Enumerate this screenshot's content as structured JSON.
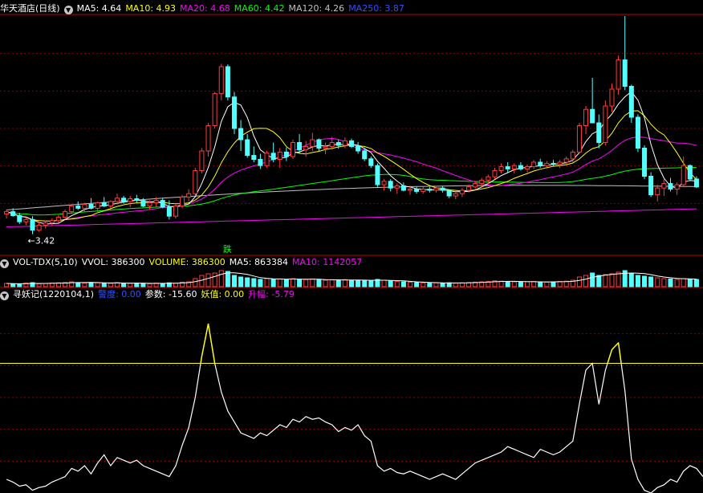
{
  "panel1": {
    "title": "华天酒店(日线)",
    "ma": [
      {
        "label": "MA5: 4.64",
        "color": "#ffffff"
      },
      {
        "label": "MA10: 4.93",
        "color": "#ffff00"
      },
      {
        "label": "MA20: 4.68",
        "color": "#ff00ff"
      },
      {
        "label": "MA60: 4.42",
        "color": "#00ff00"
      },
      {
        "label": "MA120: 4.26",
        "color": "#c0c0c0"
      },
      {
        "label": "MA250: 3.87",
        "color": "#3050ff"
      }
    ],
    "low_label": "←3.42",
    "event_label": "跌"
  },
  "panel2": {
    "title": "VOL-TDX(5,10)",
    "items": [
      {
        "label": "VVOL: 386300",
        "color": "#ffffff"
      },
      {
        "label": "VOLUME: 386300",
        "color": "#ffff00"
      },
      {
        "label": "MA5: 863384",
        "color": "#ffffff"
      },
      {
        "label": "MA10: 1142057",
        "color": "#ff00ff"
      }
    ]
  },
  "panel3": {
    "title": "寻妖记(1220104,1)",
    "items": [
      {
        "label": "警度: 0.00",
        "color": "#3050ff"
      },
      {
        "label": "参数: -15.60",
        "color": "#ffffff"
      },
      {
        "label": "妖值: 0.00",
        "color": "#ffff00"
      },
      {
        "label": "升幅: -5.79",
        "color": "#ff00ff"
      }
    ]
  },
  "colors": {
    "up": "#ff3c3c",
    "down": "#54ffff",
    "grid": "#8a0000",
    "frame": "#c00000"
  },
  "chart_data": {
    "type": "line",
    "price_range": [
      3.3,
      7.3
    ],
    "indicator_range": [
      -30,
      110
    ],
    "threshold": 65,
    "candles": [
      [
        3.78,
        3.86,
        3.7,
        3.82
      ],
      [
        3.82,
        3.88,
        3.73,
        3.75
      ],
      [
        3.75,
        3.8,
        3.6,
        3.64
      ],
      [
        3.64,
        3.72,
        3.58,
        3.68
      ],
      [
        3.68,
        3.74,
        3.42,
        3.49
      ],
      [
        3.49,
        3.64,
        3.46,
        3.58
      ],
      [
        3.58,
        3.66,
        3.52,
        3.62
      ],
      [
        3.62,
        3.7,
        3.57,
        3.66
      ],
      [
        3.66,
        3.76,
        3.62,
        3.72
      ],
      [
        3.72,
        3.86,
        3.68,
        3.82
      ],
      [
        3.82,
        3.96,
        3.78,
        3.92
      ],
      [
        3.92,
        4.0,
        3.85,
        3.88
      ],
      [
        3.88,
        3.98,
        3.82,
        3.95
      ],
      [
        3.95,
        4.06,
        3.86,
        3.88
      ],
      [
        3.88,
        4.0,
        3.8,
        3.98
      ],
      [
        3.98,
        4.08,
        3.9,
        3.92
      ],
      [
        3.92,
        4.02,
        3.88,
        4.0
      ],
      [
        4.0,
        4.14,
        3.95,
        4.06
      ],
      [
        4.06,
        4.1,
        3.96,
        4.0
      ],
      [
        4.0,
        4.1,
        3.9,
        4.05
      ],
      [
        4.05,
        4.12,
        3.98,
        4.02
      ],
      [
        4.02,
        4.06,
        3.9,
        3.92
      ],
      [
        3.92,
        4.02,
        3.86,
        3.98
      ],
      [
        3.98,
        4.08,
        3.9,
        4.02
      ],
      [
        4.02,
        4.06,
        3.88,
        3.9
      ],
      [
        3.9,
        4.02,
        3.68,
        3.74
      ],
      [
        3.74,
        3.96,
        3.7,
        3.92
      ],
      [
        3.92,
        4.12,
        3.88,
        4.08
      ],
      [
        4.08,
        4.22,
        4.0,
        4.14
      ],
      [
        4.14,
        4.6,
        4.1,
        4.55
      ],
      [
        4.55,
        4.95,
        4.5,
        4.9
      ],
      [
        4.9,
        5.4,
        4.8,
        5.35
      ],
      [
        5.35,
        5.95,
        5.3,
        5.92
      ],
      [
        5.92,
        6.45,
        5.8,
        6.4
      ],
      [
        6.4,
        6.44,
        5.8,
        5.86
      ],
      [
        5.86,
        5.95,
        5.2,
        5.3
      ],
      [
        5.3,
        5.45,
        4.9,
        5.1
      ],
      [
        5.1,
        5.2,
        4.78,
        4.82
      ],
      [
        4.82,
        4.98,
        4.7,
        4.75
      ],
      [
        4.75,
        4.85,
        4.58,
        4.64
      ],
      [
        4.64,
        4.9,
        4.6,
        4.86
      ],
      [
        4.86,
        5.05,
        4.7,
        4.75
      ],
      [
        4.75,
        4.95,
        4.6,
        4.88
      ],
      [
        4.88,
        4.96,
        4.72,
        4.8
      ],
      [
        4.8,
        5.1,
        4.76,
        5.05
      ],
      [
        5.05,
        5.2,
        4.86,
        4.92
      ],
      [
        4.92,
        5.08,
        4.8,
        4.98
      ],
      [
        4.98,
        5.22,
        4.9,
        5.1
      ],
      [
        5.1,
        5.12,
        4.9,
        4.95
      ],
      [
        4.95,
        5.05,
        4.84,
        4.98
      ],
      [
        4.98,
        5.15,
        4.92,
        5.05
      ],
      [
        5.05,
        5.1,
        4.94,
        5.0
      ],
      [
        5.0,
        5.14,
        4.95,
        5.08
      ],
      [
        5.08,
        5.12,
        4.95,
        4.98
      ],
      [
        4.98,
        5.06,
        4.85,
        4.9
      ],
      [
        4.9,
        4.95,
        4.72,
        4.76
      ],
      [
        4.76,
        4.8,
        4.6,
        4.64
      ],
      [
        4.64,
        4.68,
        4.26,
        4.3
      ],
      [
        4.3,
        4.4,
        4.2,
        4.36
      ],
      [
        4.36,
        4.4,
        4.18,
        4.24
      ],
      [
        4.24,
        4.32,
        4.14,
        4.28
      ],
      [
        4.28,
        4.34,
        4.18,
        4.2
      ],
      [
        4.2,
        4.28,
        4.12,
        4.22
      ],
      [
        4.22,
        4.26,
        4.14,
        4.18
      ],
      [
        4.18,
        4.26,
        4.14,
        4.22
      ],
      [
        4.22,
        4.26,
        4.16,
        4.2
      ],
      [
        4.2,
        4.28,
        4.16,
        4.24
      ],
      [
        4.24,
        4.28,
        4.16,
        4.2
      ],
      [
        4.2,
        4.22,
        4.06,
        4.1
      ],
      [
        4.1,
        4.18,
        4.04,
        4.14
      ],
      [
        4.14,
        4.24,
        4.08,
        4.2
      ],
      [
        4.2,
        4.3,
        4.16,
        4.26
      ],
      [
        4.26,
        4.36,
        4.22,
        4.32
      ],
      [
        4.32,
        4.42,
        4.26,
        4.38
      ],
      [
        4.38,
        4.48,
        4.3,
        4.44
      ],
      [
        4.44,
        4.6,
        4.4,
        4.55
      ],
      [
        4.55,
        4.68,
        4.5,
        4.62
      ],
      [
        4.62,
        4.7,
        4.52,
        4.58
      ],
      [
        4.58,
        4.68,
        4.5,
        4.64
      ],
      [
        4.64,
        4.7,
        4.55,
        4.58
      ],
      [
        4.58,
        4.66,
        4.52,
        4.62
      ],
      [
        4.62,
        4.74,
        4.58,
        4.7
      ],
      [
        4.7,
        4.76,
        4.6,
        4.64
      ],
      [
        4.64,
        4.72,
        4.58,
        4.68
      ],
      [
        4.68,
        4.74,
        4.62,
        4.66
      ],
      [
        4.66,
        4.74,
        4.6,
        4.7
      ],
      [
        4.7,
        4.8,
        4.66,
        4.76
      ],
      [
        4.76,
        4.92,
        4.7,
        4.88
      ],
      [
        4.88,
        5.4,
        4.85,
        5.35
      ],
      [
        5.35,
        5.7,
        5.2,
        5.64
      ],
      [
        5.64,
        6.2,
        5.5,
        5.4
      ],
      [
        5.4,
        5.55,
        4.95,
        5.05
      ],
      [
        5.05,
        5.8,
        5.0,
        5.7
      ],
      [
        5.7,
        6.1,
        5.6,
        6.0
      ],
      [
        6.0,
        6.6,
        5.9,
        6.52
      ],
      [
        6.52,
        7.3,
        5.98,
        6.05
      ],
      [
        6.05,
        6.08,
        5.4,
        5.5
      ],
      [
        5.5,
        5.55,
        4.88,
        4.95
      ],
      [
        4.95,
        5.0,
        4.4,
        4.45
      ],
      [
        4.45,
        4.52,
        4.08,
        4.12
      ],
      [
        4.12,
        4.3,
        4.0,
        4.24
      ],
      [
        4.24,
        4.4,
        4.1,
        4.32
      ],
      [
        4.32,
        4.42,
        4.18,
        4.22
      ],
      [
        4.22,
        4.34,
        4.12,
        4.3
      ],
      [
        4.3,
        4.8,
        4.25,
        4.64
      ],
      [
        4.64,
        4.66,
        4.36,
        4.4
      ],
      [
        4.4,
        4.45,
        4.24,
        4.26
      ]
    ],
    "volume_ratio": [
      0.2,
      0.18,
      0.16,
      0.22,
      0.25,
      0.18,
      0.2,
      0.22,
      0.24,
      0.26,
      0.3,
      0.25,
      0.22,
      0.26,
      0.24,
      0.22,
      0.2,
      0.25,
      0.22,
      0.2,
      0.22,
      0.2,
      0.18,
      0.22,
      0.2,
      0.24,
      0.22,
      0.28,
      0.3,
      0.5,
      0.7,
      0.8,
      0.85,
      1.0,
      0.95,
      0.7,
      0.6,
      0.55,
      0.5,
      0.45,
      0.5,
      0.45,
      0.48,
      0.44,
      0.5,
      0.46,
      0.44,
      0.48,
      0.42,
      0.4,
      0.42,
      0.4,
      0.44,
      0.4,
      0.38,
      0.4,
      0.36,
      0.45,
      0.4,
      0.35,
      0.32,
      0.3,
      0.28,
      0.26,
      0.24,
      0.22,
      0.24,
      0.22,
      0.24,
      0.22,
      0.24,
      0.26,
      0.28,
      0.3,
      0.32,
      0.36,
      0.34,
      0.32,
      0.3,
      0.28,
      0.3,
      0.32,
      0.3,
      0.28,
      0.3,
      0.32,
      0.34,
      0.4,
      0.6,
      0.7,
      0.85,
      0.7,
      0.75,
      0.8,
      0.9,
      1.0,
      0.8,
      0.7,
      0.65,
      0.6,
      0.55,
      0.5,
      0.48,
      0.45,
      0.5,
      0.48,
      0.45
    ],
    "indicator": [
      -20,
      -22,
      -25,
      -24,
      -28,
      -26,
      -25,
      -22,
      -20,
      -18,
      -12,
      -14,
      -10,
      -16,
      -8,
      -2,
      -10,
      -4,
      -6,
      -8,
      -6,
      -10,
      -12,
      -14,
      -16,
      -18,
      -10,
      5,
      18,
      40,
      70,
      94,
      65,
      44,
      30,
      22,
      14,
      12,
      10,
      14,
      12,
      16,
      20,
      18,
      24,
      22,
      26,
      24,
      25,
      22,
      20,
      15,
      18,
      16,
      20,
      12,
      8,
      -10,
      -14,
      -12,
      -15,
      -16,
      -14,
      -16,
      -18,
      -20,
      -18,
      -16,
      -18,
      -20,
      -16,
      -12,
      -8,
      -6,
      -4,
      -2,
      0,
      4,
      2,
      0,
      -2,
      -4,
      2,
      0,
      -2,
      0,
      4,
      8,
      35,
      60,
      65,
      35,
      60,
      75,
      80,
      45,
      -5,
      -20,
      -28,
      -30,
      -26,
      -24,
      -20,
      -22,
      -14,
      -10,
      -12,
      -18
    ]
  }
}
